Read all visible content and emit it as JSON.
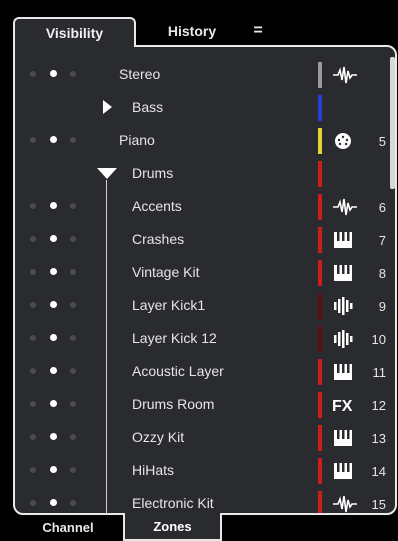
{
  "tabs": {
    "visibility": "Visibility",
    "history": "History",
    "menu": "="
  },
  "bottom_tabs": {
    "channel": "Channel",
    "zones": "Zones"
  },
  "tracks": [
    {
      "name": "Stereo",
      "number": "",
      "icon": "audio-waveform-icon",
      "color": "#9a9a9a",
      "dots": [
        false,
        true,
        false
      ]
    },
    {
      "name": "Bass",
      "number": "",
      "icon": "",
      "color": "#2a3bd6",
      "dots": []
    },
    {
      "name": "Piano",
      "number": "5",
      "icon": "midi-port-icon",
      "color": "#e8d23a",
      "dots": [
        false,
        true,
        false
      ]
    },
    {
      "name": "Drums",
      "number": "",
      "icon": "",
      "color": "#c81e1e",
      "dots": []
    },
    {
      "name": "Accents",
      "number": "6",
      "icon": "audio-waveform-icon",
      "color": "#c81e1e",
      "dots": [
        false,
        true,
        false
      ]
    },
    {
      "name": "Crashes",
      "number": "7",
      "icon": "instrument-keys-icon",
      "color": "#c81e1e",
      "dots": [
        false,
        true,
        false
      ]
    },
    {
      "name": "Vintage Kit",
      "number": "8",
      "icon": "instrument-keys-icon",
      "color": "#c81e1e",
      "dots": [
        false,
        true,
        false
      ]
    },
    {
      "name": "Layer Kick1",
      "number": "9",
      "icon": "sampler-icon",
      "color": "#5a1010",
      "dots": [
        false,
        true,
        false
      ]
    },
    {
      "name": "Layer Kick 12",
      "number": "10",
      "icon": "sampler-icon",
      "color": "#5a1010",
      "dots": [
        false,
        true,
        false
      ]
    },
    {
      "name": "Acoustic Layer",
      "number": "11",
      "icon": "instrument-keys-icon",
      "color": "#c81e1e",
      "dots": [
        false,
        true,
        false
      ]
    },
    {
      "name": "Drums Room",
      "number": "12",
      "icon": "fx-icon",
      "color": "#c81e1e",
      "dots": [
        false,
        true,
        false
      ]
    },
    {
      "name": "Ozzy Kit",
      "number": "13",
      "icon": "instrument-keys-icon",
      "color": "#c81e1e",
      "dots": [
        false,
        true,
        false
      ]
    },
    {
      "name": "HiHats",
      "number": "14",
      "icon": "instrument-keys-icon",
      "color": "#c81e1e",
      "dots": [
        false,
        true,
        false
      ]
    },
    {
      "name": "Electronic Kit",
      "number": "15",
      "icon": "audio-waveform-icon",
      "color": "#c81e1e",
      "dots": [
        false,
        true,
        false
      ]
    }
  ],
  "fx_label": "FX"
}
